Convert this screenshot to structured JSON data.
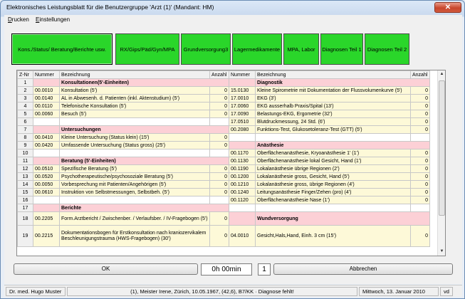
{
  "window": {
    "title": "Elektronisches Leistungsblatt für die Benutzergruppe 'Arzt (1)'  (Mandant: HM)",
    "close_glyph": "✕"
  },
  "menu": [
    {
      "label": "Drucken",
      "accel": "D",
      "rest": "rucken"
    },
    {
      "label": "Einstellungen",
      "accel": "E",
      "rest": "instellungen"
    }
  ],
  "tabs": [
    {
      "label": "Kons./Status/ Beratung/Berichte usw."
    },
    {
      "label": "RX/Gips/Päd/Gyn/MPA"
    },
    {
      "label": "Grundversorgung3"
    },
    {
      "label": "Lagermedikamente"
    },
    {
      "label": "MPA, Labor"
    },
    {
      "label": "Diagnosen Teil 1"
    },
    {
      "label": "Diagnosen Teil 2"
    }
  ],
  "grid": {
    "headers": {
      "znr": "Z-Nr",
      "nummer": "Nummer",
      "bezeichnung": "Bezeichnung",
      "anzahl": "Anzahl",
      "nummer2": "Nummer",
      "bezeichnung2": "Bezeichnung",
      "anzahl2": "Anzahl"
    },
    "rows": [
      {
        "nr": "1",
        "l_num": "",
        "l_text": "Konsultationen(5'-Einheiten)",
        "l_qty": "",
        "l_cat": true,
        "r_num": "",
        "r_text": "Diagnostik",
        "r_qty": "",
        "r_cat": true
      },
      {
        "nr": "2",
        "l_num": "00.0010",
        "l_text": "Konsultation (5')",
        "l_qty": "0",
        "r_num": "15.0130",
        "r_text": "Kleine Spirometrie mit Dokumentation der Flussvolumenkurve (5')",
        "r_qty": "0"
      },
      {
        "nr": "3",
        "l_num": "00.0140",
        "l_text": "AL in Abwesenh. d. Patienten (inkl. Aktenstudium) (5')",
        "l_qty": "0",
        "r_num": "17.0010",
        "r_text": "EKG (3')",
        "r_qty": "0"
      },
      {
        "nr": "4",
        "l_num": "00.0110",
        "l_text": "Telefonische Konsultation (5')",
        "l_qty": "0",
        "r_num": "17.0060",
        "r_text": "EKG ausserhalb Praxis/Spital (13')",
        "r_qty": "0"
      },
      {
        "nr": "5",
        "l_num": "00.0060",
        "l_text": "Besuch (5')",
        "l_qty": "0",
        "r_num": "17.0090",
        "r_text": "Belastungs-EKG, Ergometrie (32')",
        "r_qty": "0"
      },
      {
        "nr": "6",
        "l_num": "",
        "l_text": "",
        "l_qty": "",
        "l_empty": true,
        "r_num": "17.0510",
        "r_text": "Blutdruckmessung, 24 Std. (6')",
        "r_qty": "0"
      },
      {
        "nr": "7",
        "l_num": "",
        "l_text": "Untersuchungen",
        "l_qty": "",
        "l_cat": true,
        "r_num": "00.2080",
        "r_text": "Funktions-Test, Glukosetoleranz-Test (GTT) (5')",
        "r_qty": "0"
      },
      {
        "nr": "8",
        "l_num": "00.0410",
        "l_text": "Kleine Untersuchung (Status klein) (15')",
        "l_qty": "0",
        "r_num": "",
        "r_text": "",
        "r_qty": "",
        "r_empty": true
      },
      {
        "nr": "9",
        "l_num": "00.0420",
        "l_text": "Umfassende Untersuchung (Status gross) (25')",
        "l_qty": "0",
        "r_num": "",
        "r_text": "Anästhesie",
        "r_qty": "",
        "r_cat": true
      },
      {
        "nr": "10",
        "l_num": "",
        "l_text": "",
        "l_qty": "",
        "l_empty": true,
        "r_num": "00.1170",
        "r_text": "Oberflächenanästhesie, Kryoanästhesie  1' (1')",
        "r_qty": "0"
      },
      {
        "nr": "11",
        "l_num": "",
        "l_text": "Beratung    (5'-Einheiten)",
        "l_qty": "",
        "l_cat": true,
        "r_num": "00.1130",
        "r_text": "Oberflächenanästhesie lokal Gesicht, Hand (1')",
        "r_qty": "0"
      },
      {
        "nr": "12",
        "l_num": "00.0510",
        "l_text": "Spezifische Beratung (5')",
        "l_qty": "0",
        "r_num": "00.1190",
        "r_text": "Lokalanästhesie übrige Regionen (2')",
        "r_qty": "0"
      },
      {
        "nr": "13",
        "l_num": "00.0520",
        "l_text": "Psychotherapeutische/psychosoziale Beratung (5')",
        "l_qty": "0",
        "r_num": "00.1200",
        "r_text": "Lokalanästhesie gross, Gesicht, Hand (5')",
        "r_qty": "0"
      },
      {
        "nr": "14",
        "l_num": "00.0050",
        "l_text": "Vorbesprechung mit Patienten/Angehörigen (5')",
        "l_qty": "0",
        "r_num": "00.1210",
        "r_text": "Lokalanästhesie gross, übrige Regionen (4')",
        "r_qty": "0"
      },
      {
        "nr": "15",
        "l_num": "00.0610",
        "l_text": "Instruktion von Selbstmessungen, Selbstbeh. (5')",
        "l_qty": "0",
        "r_num": "00.1240",
        "r_text": "Leitungsanästhesie Finger/Zehen (pro) (4')",
        "r_qty": "0"
      },
      {
        "nr": "16",
        "l_num": "",
        "l_text": "",
        "l_qty": "",
        "l_empty": true,
        "r_num": "00.1120",
        "r_text": "Oberflächenanästhesie Nase (1')",
        "r_qty": "0"
      },
      {
        "nr": "17",
        "l_num": "",
        "l_text": "Berichte",
        "l_qty": "",
        "l_cat": true,
        "r_num": "",
        "r_text": "",
        "r_qty": "",
        "r_empty": true
      },
      {
        "nr": "18",
        "l_num": "00.2205",
        "l_text": "Form.Arztbericht / Zwischenber. / Verlaufsber. / IV-Fragebogen (5')",
        "l_qty": "0",
        "r_num": "",
        "r_text": "Wundversorgung",
        "r_qty": "",
        "r_cat": true,
        "tall": true
      },
      {
        "nr": "19",
        "l_num": "00.2215",
        "l_text": "Dokumentationsbogen für Erstkonsultation nach kraniozervikalem Beschleunigungstrauma (HWS-Fragebogen) (30')",
        "l_qty": "0",
        "r_num": "04.0010",
        "r_text": "Gesicht,Hals,Hand, Einh. 3 cm (15')",
        "r_qty": "0",
        "tall2": true
      }
    ]
  },
  "scrollbar": {
    "up": "▲",
    "down": "▼"
  },
  "buttons": {
    "ok": "OK",
    "cancel": "Abbrechen"
  },
  "timer": "0h 00min",
  "counter": "1",
  "status": {
    "user": "Dr. med. Hugo Muster",
    "patient": "(1), Meister Irene, Zürich, 10.05.1967, (42,6), B7/KK · Diagnose fehlt!",
    "date": "Mittwoch, 13. Januar 2010",
    "code": "vd"
  }
}
